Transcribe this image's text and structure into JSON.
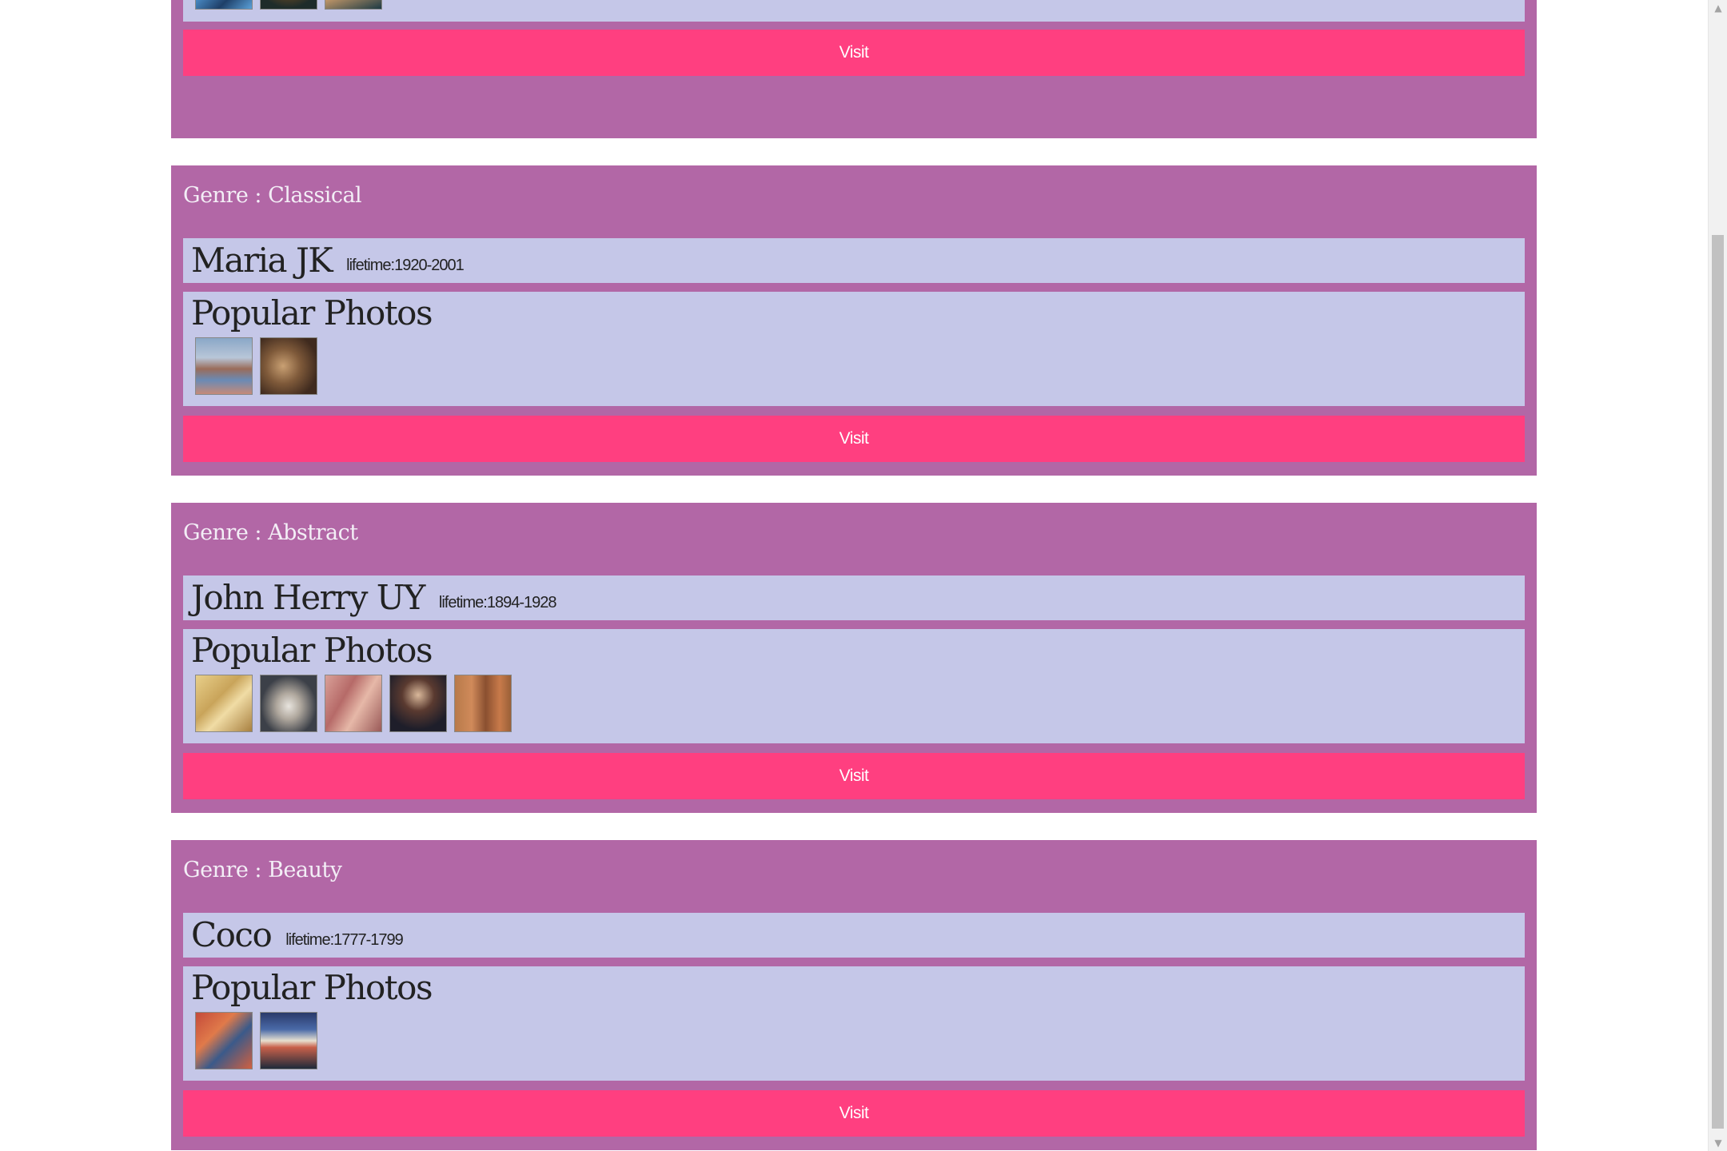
{
  "scrollbar": {
    "up_arrow": "▲",
    "down_arrow": "▼"
  },
  "partial_card": {
    "visit_label": "Visit",
    "thumbnails": [
      "t-blue1",
      "t-blue2",
      "t-blue3"
    ]
  },
  "cards": [
    {
      "genre_label": "Genre : Classical",
      "artist_name": "Maria JK",
      "lifetime": "lifetime:1920-2001",
      "photos_title": "Popular Photos",
      "visit_label": "Visit",
      "thumbnails": [
        "t-c1",
        "t-c2"
      ]
    },
    {
      "genre_label": "Genre : Abstract",
      "artist_name": "John Herry UY",
      "lifetime": "lifetime:1894-1928",
      "photos_title": "Popular Photos",
      "visit_label": "Visit",
      "thumbnails": [
        "t-a1",
        "t-a2",
        "t-a3",
        "t-a4",
        "t-a5"
      ]
    },
    {
      "genre_label": "Genre : Beauty",
      "artist_name": "Coco",
      "lifetime": "lifetime:1777-1799",
      "photos_title": "Popular Photos",
      "visit_label": "Visit",
      "thumbnails": [
        "t-b1",
        "t-b2"
      ]
    }
  ],
  "colors": {
    "card_background": "#b267a6",
    "panel_background": "#c5c7e8",
    "visit_button": "#ff3f80"
  }
}
